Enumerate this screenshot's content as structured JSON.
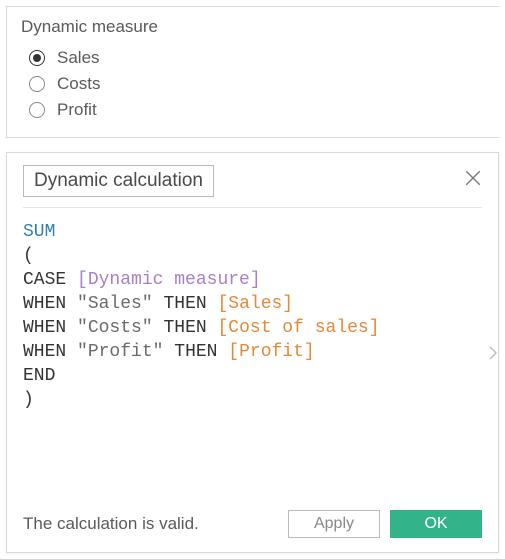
{
  "parameter": {
    "title": "Dynamic measure",
    "options": [
      "Sales",
      "Costs",
      "Profit"
    ],
    "selected": "Sales"
  },
  "calc": {
    "name": "Dynamic calculation",
    "status": "The calculation is valid.",
    "buttons": {
      "apply": "Apply",
      "ok": "OK"
    },
    "code": {
      "func": "SUM",
      "open": "(",
      "case_kw": "CASE",
      "case_param": "[Dynamic measure]",
      "when": [
        {
          "kw1": "WHEN",
          "str": "\"Sales\"",
          "kw2": "THEN",
          "field": "[Sales]"
        },
        {
          "kw1": "WHEN",
          "str": "\"Costs\"",
          "kw2": "THEN",
          "field": "[Cost of sales]"
        },
        {
          "kw1": "WHEN",
          "str": "\"Profit\"",
          "kw2": "THEN",
          "field": "[Profit]"
        }
      ],
      "end": "END",
      "close": ")"
    }
  }
}
